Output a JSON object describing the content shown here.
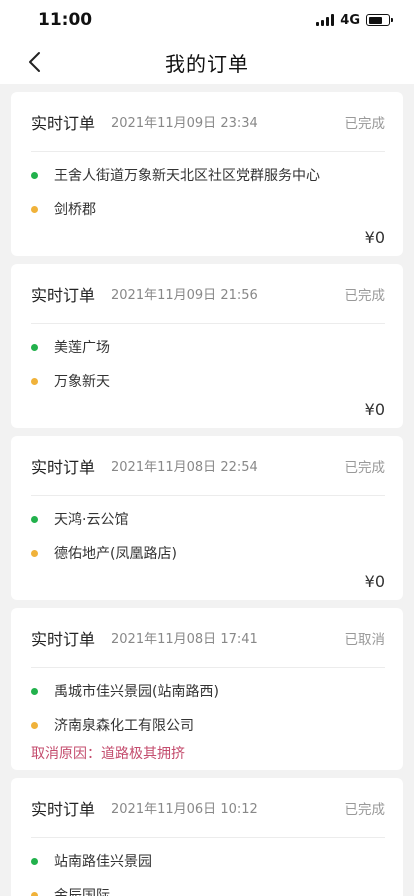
{
  "status_bar": {
    "time": "11:00",
    "network": "4G"
  },
  "nav": {
    "title": "我的订单"
  },
  "orders": [
    {
      "type": "实时订单",
      "time": "2021年11月09日 23:34",
      "status": "已完成",
      "start": "王舍人街道万象新天北区社区党群服务中心",
      "end": "剑桥郡",
      "price": "¥0"
    },
    {
      "type": "实时订单",
      "time": "2021年11月09日 21:56",
      "status": "已完成",
      "start": "美莲广场",
      "end": "万象新天",
      "price": "¥0"
    },
    {
      "type": "实时订单",
      "time": "2021年11月08日 22:54",
      "status": "已完成",
      "start": "天鸿·云公馆",
      "end": "德佑地产(凤凰路店)",
      "price": "¥0"
    },
    {
      "type": "实时订单",
      "time": "2021年11月08日 17:41",
      "status": "已取消",
      "start": "禹城市佳兴景园(站南路西)",
      "end": "济南泉森化工有限公司",
      "cancel_reason": "取消原因：道路极其拥挤"
    },
    {
      "type": "实时订单",
      "time": "2021年11月06日 10:12",
      "status": "已完成",
      "start": "站南路佳兴景园",
      "end": "金辰国际"
    }
  ],
  "icons": {
    "back": "chevron-left-icon"
  },
  "colors": {
    "start_dot": "#22b14c",
    "end_dot": "#f0b23a",
    "cancel": "#c44d6e"
  }
}
